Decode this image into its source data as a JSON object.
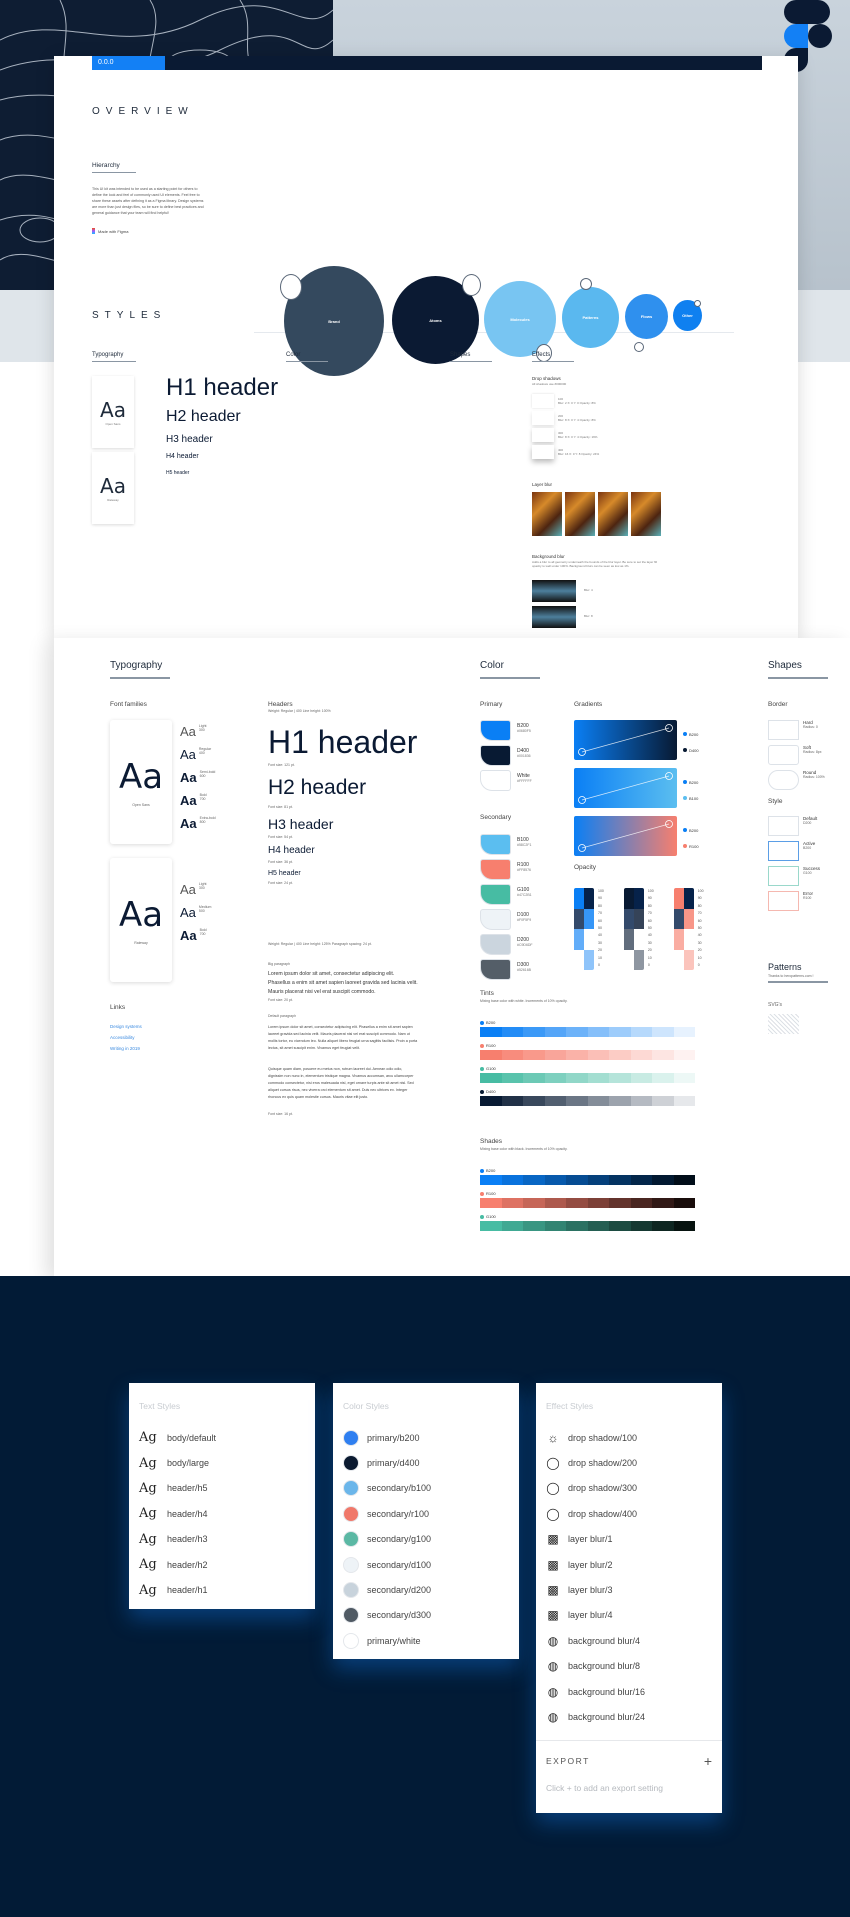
{
  "overview": {
    "version_badge": "0.0.0",
    "title": "OVERVIEW",
    "hierarchy_title": "Hierarchy",
    "hierarchy_text": "This UI kit was intended to be used as a starting point for others to define the look and feel of commonly used UI elements. Feel free to share these assets after defining it as a Figma library. Design systems are more than just design files, so be sure to define best practices and general guidance that your team will find helpful!",
    "made_with": "Made with Figma",
    "levels": [
      "Brand",
      "Atoms",
      "Molecules",
      "Patterns",
      "Flows",
      "Other"
    ]
  },
  "styles_title": "STYLES",
  "preview": {
    "typography": "Typography",
    "color": "Color",
    "shapes": "Shapes",
    "effects": "Effects",
    "drop_shadows": "Drop shadows",
    "drop_shadows_note": "All shadows use #000000",
    "shadows": [
      {
        "name": "100",
        "spec": "Blur: 2   X: 0   Y: 0   Opacity: 8%"
      },
      {
        "name": "200",
        "spec": "Blur: 8   X: 0   Y: 4   Opacity: 8%"
      },
      {
        "name": "300",
        "spec": "Blur: 8   X: 0   Y: 4   Opacity: 16%"
      },
      {
        "name": "400",
        "spec": "Blur: 16  X: 0   Y: 8   Opacity: 24%"
      }
    ],
    "layer_blur": "Layer blur",
    "background_blur": "Background blur",
    "background_blur_note": "Adds a blur to all geometry underneath the bounds of the blur layer. Be sure to set the layer fill opacity to well under 100%. Background blurs can be seen as low as 1%.",
    "blur_labels": [
      "Blur: 4",
      "Blur: 8"
    ]
  },
  "typography": {
    "title": "Typography",
    "font_families": "Font families",
    "families": [
      {
        "sample": "Aa",
        "name": "Open Sans",
        "weights": [
          {
            "name": "Light",
            "value": "300"
          },
          {
            "name": "Regular",
            "value": "400"
          },
          {
            "name": "Semi-bold",
            "value": "600"
          },
          {
            "name": "Bold",
            "value": "700"
          },
          {
            "name": "Extra-bold",
            "value": "800"
          }
        ]
      },
      {
        "sample": "Aa",
        "name": "Raleway",
        "weights": [
          {
            "name": "Light",
            "value": "300"
          },
          {
            "name": "Medium",
            "value": "500"
          },
          {
            "name": "Bold",
            "value": "700"
          }
        ]
      }
    ],
    "headers_label": "Headers",
    "headers_meta": "Weight: Regular | 400      Line height: 100%",
    "headers": [
      {
        "text": "H1 header",
        "size": "Font size: 121 pt."
      },
      {
        "text": "H2 header",
        "size": "Font size: 81 pt."
      },
      {
        "text": "H3 header",
        "size": "Font size: 54 pt."
      },
      {
        "text": "H4 header",
        "size": "Font size: 36 pt."
      },
      {
        "text": "H5 header",
        "size": "Font size: 24 pt."
      }
    ],
    "para_meta": "Weight: Regular | 400      Line height: 125%      Paragraph spacing: 24 pt.",
    "big_label": "Big paragraph",
    "big_text": "Lorem ipsum dolor sit amet, consectetur adipiscing elit. Phasellus a enim sit amet sapien laoreet gravida sed lacinia velit. Mauris placerat nisi vel erat suscipit commodo.",
    "big_size": "Font size: 20 pt.",
    "default_label": "Default paragraph",
    "default_text_1": "Lorem ipsum dolor sit amet, consectetur adipiscing elit. Phasellus a enim sit amet sapien laoreet gravida sed lacinia velit. Mauris placerat nisi vel erat suscipit commodo. Nam ut mollis tortor, eu vicendum leo. Nulla aliquet libero feugiat urna sagittis facilisis. Proin a porta lectus, sit amet suscipit enim. Vivamus eget feugiat velit.",
    "default_text_2": "Quisque quam diam, posuere eu metus non, rutrum laoreet dui. Aenean odio odio, dignissim non nunc in, elementum tristique magna. Vivamus accumsan, arcu ullamcorper commodo consectetur, nisi eros malesuada nisl, eget ornare turpis ante sit amet nisl. Sed aliquet cursus risus, nec viverra orci elementum sit amet. Duis nec ultrices ex. Integer rhoncus ex quis quam molestie cursus. Mauris vitae elit justo.",
    "default_size": "Font size: 16 pt.",
    "links_title": "Links",
    "links": [
      "Design systems",
      "Accessibility",
      "Writing in 2019"
    ]
  },
  "color": {
    "title": "Color",
    "primary_label": "Primary",
    "primary": [
      {
        "name": "B200",
        "hex": "#0680F5",
        "css": "#0a7ff5"
      },
      {
        "name": "D400",
        "hex": "#001836",
        "css": "#081a33"
      },
      {
        "name": "White",
        "hex": "#FFFFFF",
        "css": "#ffffff"
      }
    ],
    "secondary_label": "Secondary",
    "secondary": [
      {
        "name": "B100",
        "hex": "#58C2F1",
        "css": "#5bbef0"
      },
      {
        "name": "R100",
        "hex": "#FF8576",
        "css": "#f77f6e"
      },
      {
        "name": "G100",
        "hex": "#47C2B1",
        "css": "#47bca3"
      },
      {
        "name": "D100",
        "hex": "#F0F5F9",
        "css": "#eef3f7"
      },
      {
        "name": "D200",
        "hex": "#C9D6DF",
        "css": "#cbd5de"
      },
      {
        "name": "D300",
        "hex": "#52616B",
        "css": "#545e68"
      }
    ],
    "gradients_label": "Gradients",
    "gradients": [
      {
        "a": "B200",
        "b": "D400",
        "from": "#0a7ff5",
        "to": "#081a33"
      },
      {
        "a": "B200",
        "b": "B100",
        "from": "#0a7ff5",
        "to": "#5bbef0"
      },
      {
        "a": "B200",
        "b": "R100",
        "from": "#0a7ff5",
        "to": "#f77f6e"
      }
    ],
    "opacity_label": "Opacity",
    "opacity_steps": [
      "100",
      "90",
      "80",
      "70",
      "60",
      "50",
      "40",
      "30",
      "20",
      "10",
      "0"
    ],
    "tints_label": "Tints",
    "tints_note": "Mixing base color with white. Increments of 10% opacity.",
    "tints": [
      {
        "name": "B200",
        "color": "#0a7ff5"
      },
      {
        "name": "R100",
        "color": "#f77f6e"
      },
      {
        "name": "G100",
        "color": "#47bca3"
      },
      {
        "name": "D400",
        "color": "#081a33"
      }
    ],
    "shades_label": "Shades",
    "shades_note": "Mixing base color with black. Increments of 10% opacity.",
    "shades": [
      {
        "name": "B200",
        "color": "#0a7ff5"
      },
      {
        "name": "R100",
        "color": "#f77f6e"
      },
      {
        "name": "G100",
        "color": "#47bca3"
      }
    ]
  },
  "shapes": {
    "title": "Shapes",
    "border_label": "Border",
    "borders": [
      {
        "name": "Hard",
        "note": "Radius: 0"
      },
      {
        "name": "Soft",
        "note": "Radius: 8px"
      },
      {
        "name": "Round",
        "note": "Radius: 100%"
      }
    ],
    "style_label": "Style",
    "styles": [
      {
        "name": "Default",
        "note": "D200",
        "color": "#dde2e8"
      },
      {
        "name": "Active",
        "note": "B200",
        "color": "#5b9ee6"
      },
      {
        "name": "Success",
        "note": "G100",
        "color": "#9ad8cb"
      },
      {
        "name": "Error",
        "note": "R100",
        "color": "#f5b8b0"
      }
    ],
    "patterns_title": "Patterns",
    "patterns_note": "Thanks to heropatterns.com !",
    "svgs_label": "SVG's"
  },
  "panels": {
    "text_styles": {
      "title": "Text Styles",
      "items": [
        "body/default",
        "body/large",
        "header/h5",
        "header/h4",
        "header/h3",
        "header/h2",
        "header/h1"
      ],
      "glyph": "Ag"
    },
    "color_styles": {
      "title": "Color Styles",
      "items": [
        {
          "name": "primary/b200",
          "color": "#2f7ff0"
        },
        {
          "name": "primary/d400",
          "color": "#0b1a30"
        },
        {
          "name": "secondary/b100",
          "color": "#6bb6ea"
        },
        {
          "name": "secondary/r100",
          "color": "#f0786a"
        },
        {
          "name": "secondary/g100",
          "color": "#5bb8a4"
        },
        {
          "name": "secondary/d100",
          "color": "#eef3f7"
        },
        {
          "name": "secondary/d200",
          "color": "#c8d3dc"
        },
        {
          "name": "secondary/d300",
          "color": "#505a64"
        },
        {
          "name": "primary/white",
          "color": "#ffffff"
        }
      ]
    },
    "effect_styles": {
      "title": "Effect Styles",
      "items": [
        {
          "name": "drop shadow/100",
          "icon": "sun-icon",
          "glyph": "☼"
        },
        {
          "name": "drop shadow/200",
          "icon": "drop-shadow-icon",
          "glyph": "◯"
        },
        {
          "name": "drop shadow/300",
          "icon": "drop-shadow-icon",
          "glyph": "◯"
        },
        {
          "name": "drop shadow/400",
          "icon": "drop-shadow-icon",
          "glyph": "◯"
        },
        {
          "name": "layer blur/1",
          "icon": "layer-blur-icon",
          "glyph": "▩"
        },
        {
          "name": "layer blur/2",
          "icon": "layer-blur-icon",
          "glyph": "▩"
        },
        {
          "name": "layer blur/3",
          "icon": "layer-blur-icon",
          "glyph": "▩"
        },
        {
          "name": "layer blur/4",
          "icon": "layer-blur-icon",
          "glyph": "▩"
        },
        {
          "name": "background blur/4",
          "icon": "background-blur-icon",
          "glyph": "◍"
        },
        {
          "name": "background blur/8",
          "icon": "background-blur-icon",
          "glyph": "◍"
        },
        {
          "name": "background blur/16",
          "icon": "background-blur-icon",
          "glyph": "◍"
        },
        {
          "name": "background blur/24",
          "icon": "background-blur-icon",
          "glyph": "◍"
        }
      ],
      "export_label": "EXPORT",
      "export_add": "+",
      "export_hint": "Click + to add an export setting"
    }
  }
}
